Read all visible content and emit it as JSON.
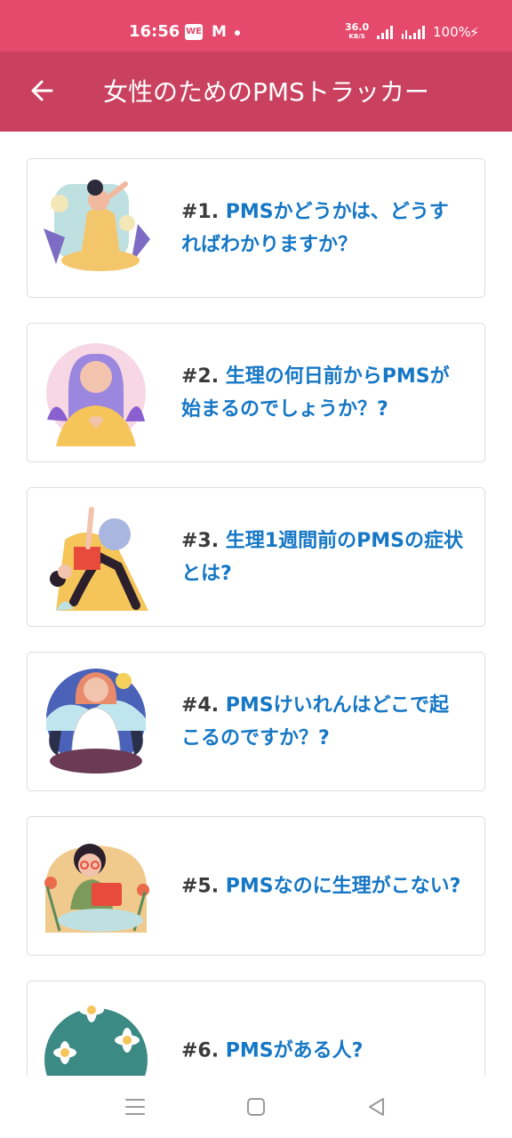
{
  "status_bar": {
    "time": "16:56",
    "app_icon_text": "WE",
    "app_m": "M",
    "net_speed": "36.0",
    "net_unit": "KB/S",
    "battery": "100%"
  },
  "app_bar": {
    "title": "女性のためのPMSトラッカー"
  },
  "articles": [
    {
      "num": "#1.",
      "title": "PMSかどうかは、どうすればわかりますか？"
    },
    {
      "num": "#2.",
      "title": "生理の何日前からPMSが始まるのでしょうか？?"
    },
    {
      "num": "#3.",
      "title": "生理1週間前のPMSの症状とは?"
    },
    {
      "num": "#4.",
      "title": "PMSけいれんはどこで起こるのですか？?"
    },
    {
      "num": "#5.",
      "title": "PMSなのに生理がこない?"
    },
    {
      "num": "#6.",
      "title": "PMSがある人?"
    }
  ],
  "colors": {
    "status_bar": "#e5496c",
    "app_bar": "#c9415f",
    "title_blue": "#1677c5",
    "number_gray": "#3b3b3b"
  },
  "icons": [
    "back-arrow-icon",
    "menu-icon",
    "home-icon",
    "back-triangle-icon"
  ]
}
